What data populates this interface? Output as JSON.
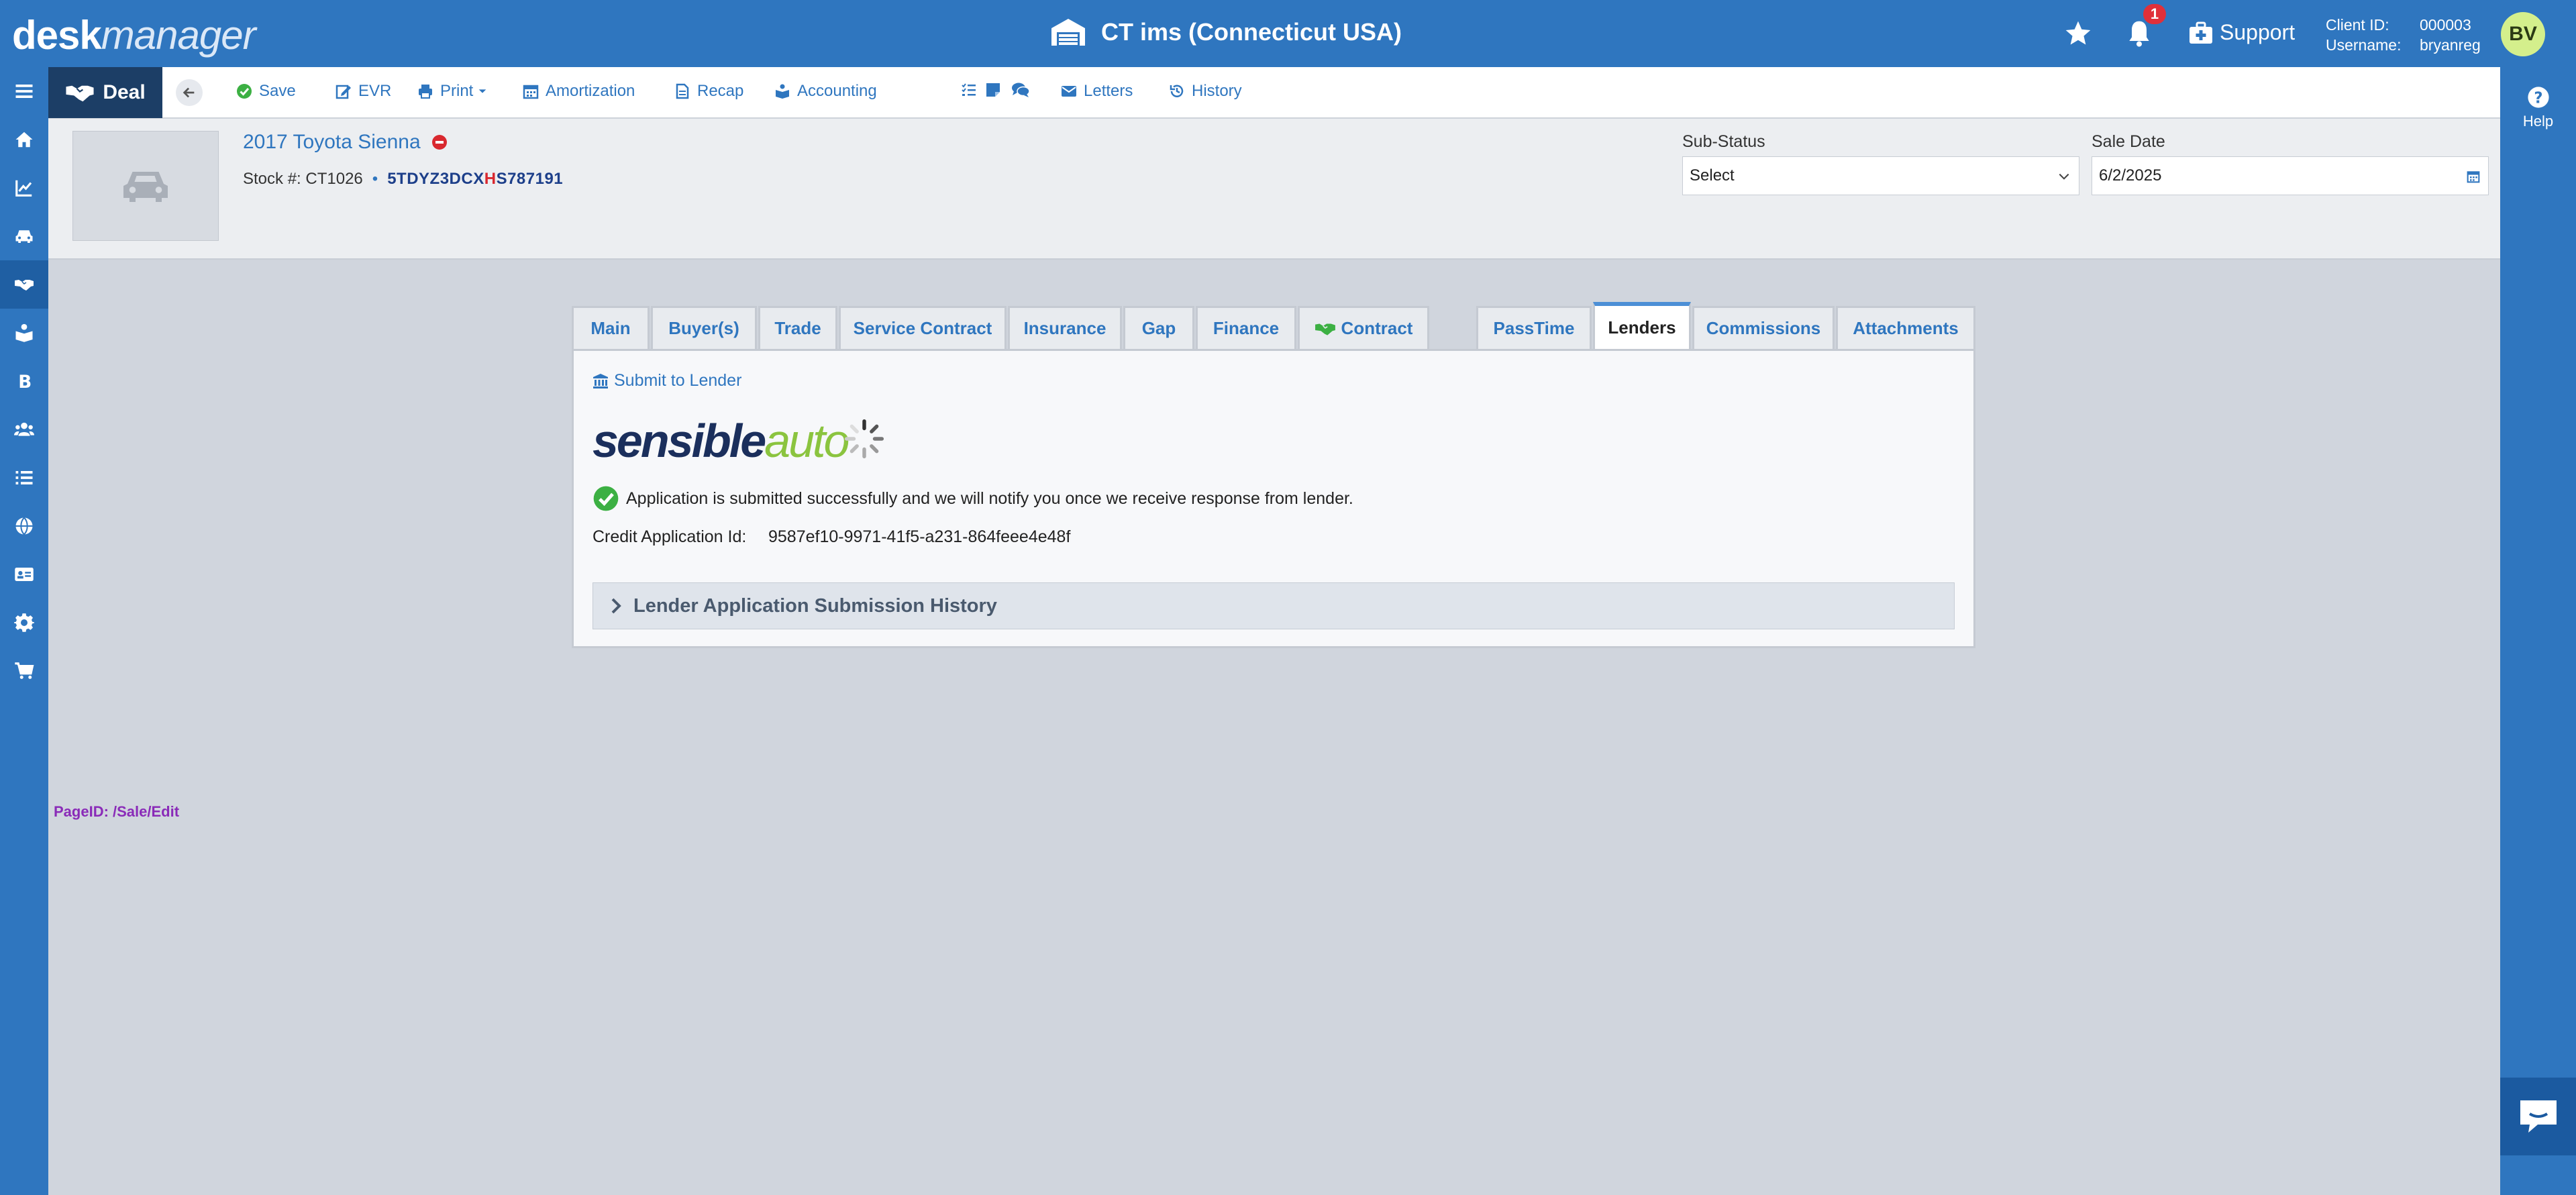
{
  "header": {
    "logo_bold": "desk",
    "logo_italic": "manager",
    "site_title": "CT ims (Connecticut USA)",
    "notification_count": "1",
    "support_label": "Support",
    "client_id_label": "Client ID:",
    "client_id_value": "000003",
    "username_label": "Username:",
    "username_value": "bryanreg",
    "avatar_initials": "BV"
  },
  "right_bar": {
    "help_label": "Help"
  },
  "toolbar": {
    "deal_label": "Deal",
    "items": [
      {
        "label": "Save",
        "icon": "check-icon"
      },
      {
        "label": "EVR",
        "icon": "edit-icon"
      },
      {
        "label": "Print",
        "icon": "print-icon"
      },
      {
        "label": "Amortization",
        "icon": "calendar-icon"
      },
      {
        "label": "Recap",
        "icon": "file-icon"
      },
      {
        "label": "Accounting",
        "icon": "book-icon"
      },
      {
        "label": "Letters",
        "icon": "envelope-icon"
      },
      {
        "label": "History",
        "icon": "history-icon"
      }
    ]
  },
  "vehicle": {
    "title": "2017 Toyota Sienna",
    "stock_label": "Stock #:",
    "stock_value": "CT1026",
    "vin_part1": "5TDYZ3DCX",
    "vin_highlight": "H",
    "vin_part2": "S787191"
  },
  "fields": {
    "sub_status_label": "Sub-Status",
    "sub_status_value": "Select",
    "sale_date_label": "Sale Date",
    "sale_date_value": "6/2/2025"
  },
  "tabs": [
    {
      "label": "Main"
    },
    {
      "label": "Buyer(s)"
    },
    {
      "label": "Trade"
    },
    {
      "label": "Service Contract"
    },
    {
      "label": "Insurance"
    },
    {
      "label": "Gap"
    },
    {
      "label": "Finance"
    },
    {
      "label": "Contract"
    },
    {
      "label": "PassTime"
    },
    {
      "label": "Lenders"
    },
    {
      "label": "Commissions"
    },
    {
      "label": "Attachments"
    }
  ],
  "lender_panel": {
    "submit_label": "Submit to Lender",
    "logo_part1": "sensible",
    "logo_part2": "auto",
    "success_message": "Application is submitted successfully and we will notify you once we receive response from lender.",
    "credit_app_label": "Credit Application Id:",
    "credit_app_value": "9587ef10-9971-41f5-a231-864feee4e48f",
    "history_label": "Lender Application Submission History"
  },
  "page_id": "PageID:  /Sale/Edit",
  "colors": {
    "primary": "#2f76bf",
    "deal_tab": "#1c3e66",
    "success": "#3cb043",
    "badge": "#e0303a",
    "page_id": "#8a2bb8"
  }
}
